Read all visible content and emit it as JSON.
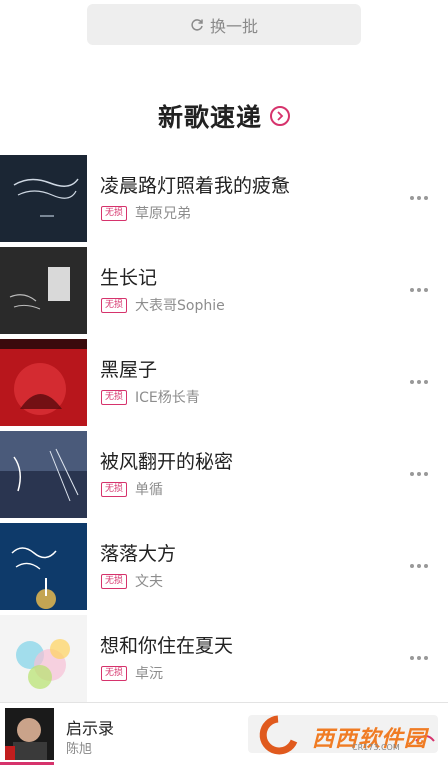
{
  "refresh": {
    "label": "换一批",
    "icon": "refresh-icon"
  },
  "section": {
    "title": "新歌速递",
    "accent": "#d6336c"
  },
  "badge_label": "无损",
  "songs": [
    {
      "title": "凌晨路灯照着我的疲惫",
      "artist": "草原兄弟",
      "cover_color": "#1b2634"
    },
    {
      "title": "生长记",
      "artist": "大表哥Sophie",
      "cover_color": "#2a2a2a"
    },
    {
      "title": "黑屋子",
      "artist": "ICE杨长青",
      "cover_color": "#b8161c"
    },
    {
      "title": "被风翻开的秘密",
      "artist": "单循",
      "cover_color": "#2a3550"
    },
    {
      "title": "落落大方",
      "artist": "文夫",
      "cover_color": "#0e3a6a"
    },
    {
      "title": "想和你住在夏天",
      "artist": "卓沅",
      "cover_color": "#f4f4f4"
    }
  ],
  "player": {
    "title": "启示录",
    "artist": "陈旭",
    "progress": 0.12
  },
  "watermark": {
    "brand": "西西软件园",
    "url": "CR173.COM"
  }
}
